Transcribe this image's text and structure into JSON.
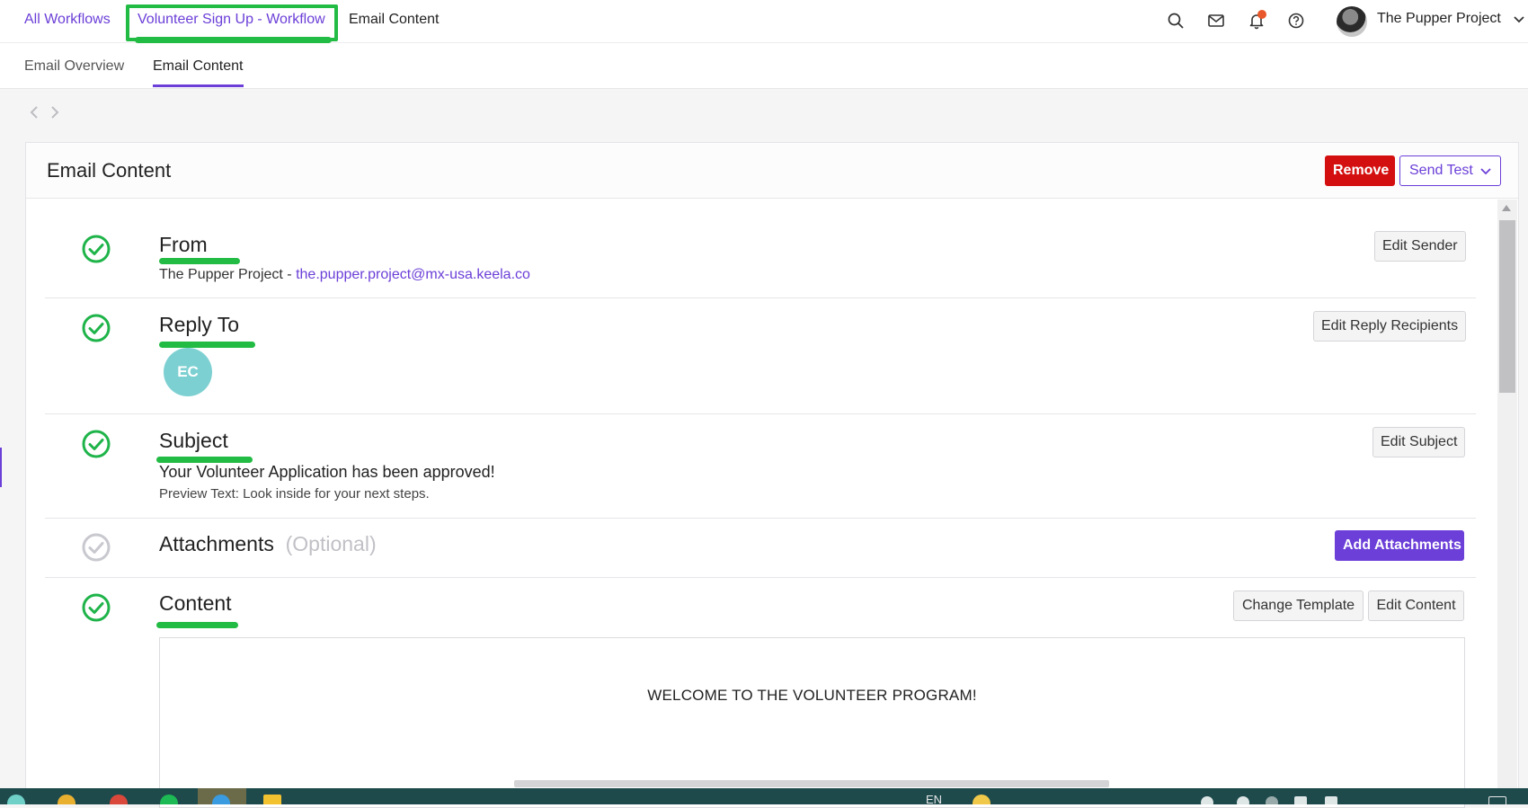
{
  "breadcrumb": {
    "all_workflows": "All Workflows",
    "workflow": "Volunteer Sign Up - Workflow",
    "current": "Email Content"
  },
  "header": {
    "org_name": "The Pupper Project",
    "icons": [
      "search-icon",
      "mail-icon",
      "bell-icon",
      "help-icon",
      "chevron-down-icon"
    ]
  },
  "tabs": {
    "overview": "Email Overview",
    "content": "Email Content",
    "active": "Email Content"
  },
  "card": {
    "title": "Email Content",
    "remove_label": "Remove",
    "send_test_label": "Send Test"
  },
  "sections": {
    "from": {
      "title": "From",
      "sender_name": "The Pupper Project - ",
      "sender_email": "the.pupper.project@mx-usa.keela.co",
      "button": "Edit Sender",
      "status": "complete"
    },
    "reply_to": {
      "title": "Reply To",
      "recipient_initials": "EC",
      "button": "Edit Reply Recipients",
      "status": "complete"
    },
    "subject": {
      "title": "Subject",
      "subject_text": "Your Volunteer Application has been approved!",
      "preview_text": "Preview Text: Look inside for your next steps.",
      "button": "Edit Subject",
      "status": "complete"
    },
    "attachments": {
      "title": "Attachments",
      "optional_label": "(Optional)",
      "button": "Add Attachments",
      "status": "incomplete"
    },
    "content": {
      "title": "Content",
      "change_template_button": "Change Template",
      "edit_button": "Edit Content",
      "preview_heading": "WELCOME TO THE VOLUNTEER PROGRAM!",
      "status": "complete"
    }
  },
  "taskbar": {
    "lang": "EN"
  },
  "colors": {
    "accent": "#6b3fd8",
    "remove": "#d40f0f",
    "check_green": "#1fb44a",
    "annotation_green": "#22bb44",
    "avatar_teal": "#7dd0d2"
  }
}
